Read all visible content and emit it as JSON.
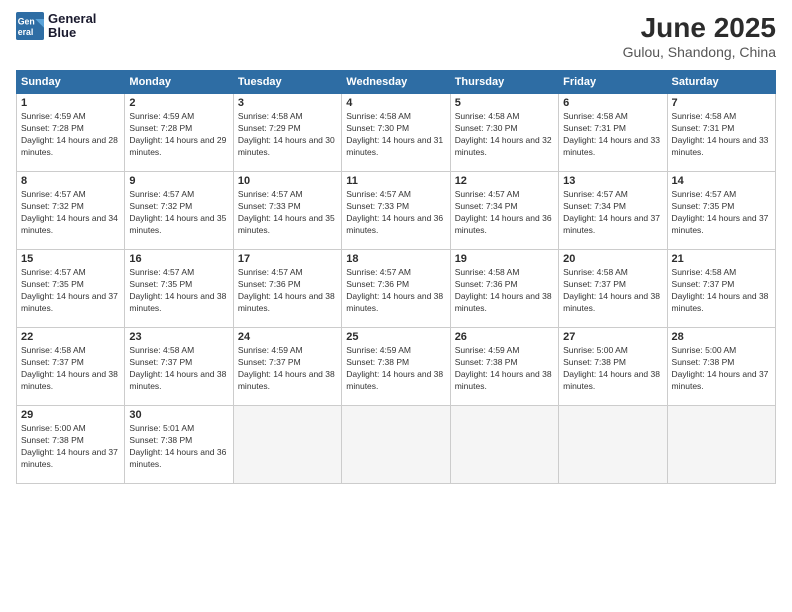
{
  "logo": {
    "line1": "General",
    "line2": "Blue"
  },
  "title": "June 2025",
  "subtitle": "Gulou, Shandong, China",
  "days_header": [
    "Sunday",
    "Monday",
    "Tuesday",
    "Wednesday",
    "Thursday",
    "Friday",
    "Saturday"
  ],
  "weeks": [
    [
      {
        "num": "1",
        "sunrise": "4:59 AM",
        "sunset": "7:28 PM",
        "daylight": "14 hours and 28 minutes."
      },
      {
        "num": "2",
        "sunrise": "4:59 AM",
        "sunset": "7:28 PM",
        "daylight": "14 hours and 29 minutes."
      },
      {
        "num": "3",
        "sunrise": "4:58 AM",
        "sunset": "7:29 PM",
        "daylight": "14 hours and 30 minutes."
      },
      {
        "num": "4",
        "sunrise": "4:58 AM",
        "sunset": "7:30 PM",
        "daylight": "14 hours and 31 minutes."
      },
      {
        "num": "5",
        "sunrise": "4:58 AM",
        "sunset": "7:30 PM",
        "daylight": "14 hours and 32 minutes."
      },
      {
        "num": "6",
        "sunrise": "4:58 AM",
        "sunset": "7:31 PM",
        "daylight": "14 hours and 33 minutes."
      },
      {
        "num": "7",
        "sunrise": "4:58 AM",
        "sunset": "7:31 PM",
        "daylight": "14 hours and 33 minutes."
      }
    ],
    [
      {
        "num": "8",
        "sunrise": "4:57 AM",
        "sunset": "7:32 PM",
        "daylight": "14 hours and 34 minutes."
      },
      {
        "num": "9",
        "sunrise": "4:57 AM",
        "sunset": "7:32 PM",
        "daylight": "14 hours and 35 minutes."
      },
      {
        "num": "10",
        "sunrise": "4:57 AM",
        "sunset": "7:33 PM",
        "daylight": "14 hours and 35 minutes."
      },
      {
        "num": "11",
        "sunrise": "4:57 AM",
        "sunset": "7:33 PM",
        "daylight": "14 hours and 36 minutes."
      },
      {
        "num": "12",
        "sunrise": "4:57 AM",
        "sunset": "7:34 PM",
        "daylight": "14 hours and 36 minutes."
      },
      {
        "num": "13",
        "sunrise": "4:57 AM",
        "sunset": "7:34 PM",
        "daylight": "14 hours and 37 minutes."
      },
      {
        "num": "14",
        "sunrise": "4:57 AM",
        "sunset": "7:35 PM",
        "daylight": "14 hours and 37 minutes."
      }
    ],
    [
      {
        "num": "15",
        "sunrise": "4:57 AM",
        "sunset": "7:35 PM",
        "daylight": "14 hours and 37 minutes."
      },
      {
        "num": "16",
        "sunrise": "4:57 AM",
        "sunset": "7:35 PM",
        "daylight": "14 hours and 38 minutes."
      },
      {
        "num": "17",
        "sunrise": "4:57 AM",
        "sunset": "7:36 PM",
        "daylight": "14 hours and 38 minutes."
      },
      {
        "num": "18",
        "sunrise": "4:57 AM",
        "sunset": "7:36 PM",
        "daylight": "14 hours and 38 minutes."
      },
      {
        "num": "19",
        "sunrise": "4:58 AM",
        "sunset": "7:36 PM",
        "daylight": "14 hours and 38 minutes."
      },
      {
        "num": "20",
        "sunrise": "4:58 AM",
        "sunset": "7:37 PM",
        "daylight": "14 hours and 38 minutes."
      },
      {
        "num": "21",
        "sunrise": "4:58 AM",
        "sunset": "7:37 PM",
        "daylight": "14 hours and 38 minutes."
      }
    ],
    [
      {
        "num": "22",
        "sunrise": "4:58 AM",
        "sunset": "7:37 PM",
        "daylight": "14 hours and 38 minutes."
      },
      {
        "num": "23",
        "sunrise": "4:58 AM",
        "sunset": "7:37 PM",
        "daylight": "14 hours and 38 minutes."
      },
      {
        "num": "24",
        "sunrise": "4:59 AM",
        "sunset": "7:37 PM",
        "daylight": "14 hours and 38 minutes."
      },
      {
        "num": "25",
        "sunrise": "4:59 AM",
        "sunset": "7:38 PM",
        "daylight": "14 hours and 38 minutes."
      },
      {
        "num": "26",
        "sunrise": "4:59 AM",
        "sunset": "7:38 PM",
        "daylight": "14 hours and 38 minutes."
      },
      {
        "num": "27",
        "sunrise": "5:00 AM",
        "sunset": "7:38 PM",
        "daylight": "14 hours and 38 minutes."
      },
      {
        "num": "28",
        "sunrise": "5:00 AM",
        "sunset": "7:38 PM",
        "daylight": "14 hours and 37 minutes."
      }
    ],
    [
      {
        "num": "29",
        "sunrise": "5:00 AM",
        "sunset": "7:38 PM",
        "daylight": "14 hours and 37 minutes."
      },
      {
        "num": "30",
        "sunrise": "5:01 AM",
        "sunset": "7:38 PM",
        "daylight": "14 hours and 36 minutes."
      },
      null,
      null,
      null,
      null,
      null
    ]
  ]
}
